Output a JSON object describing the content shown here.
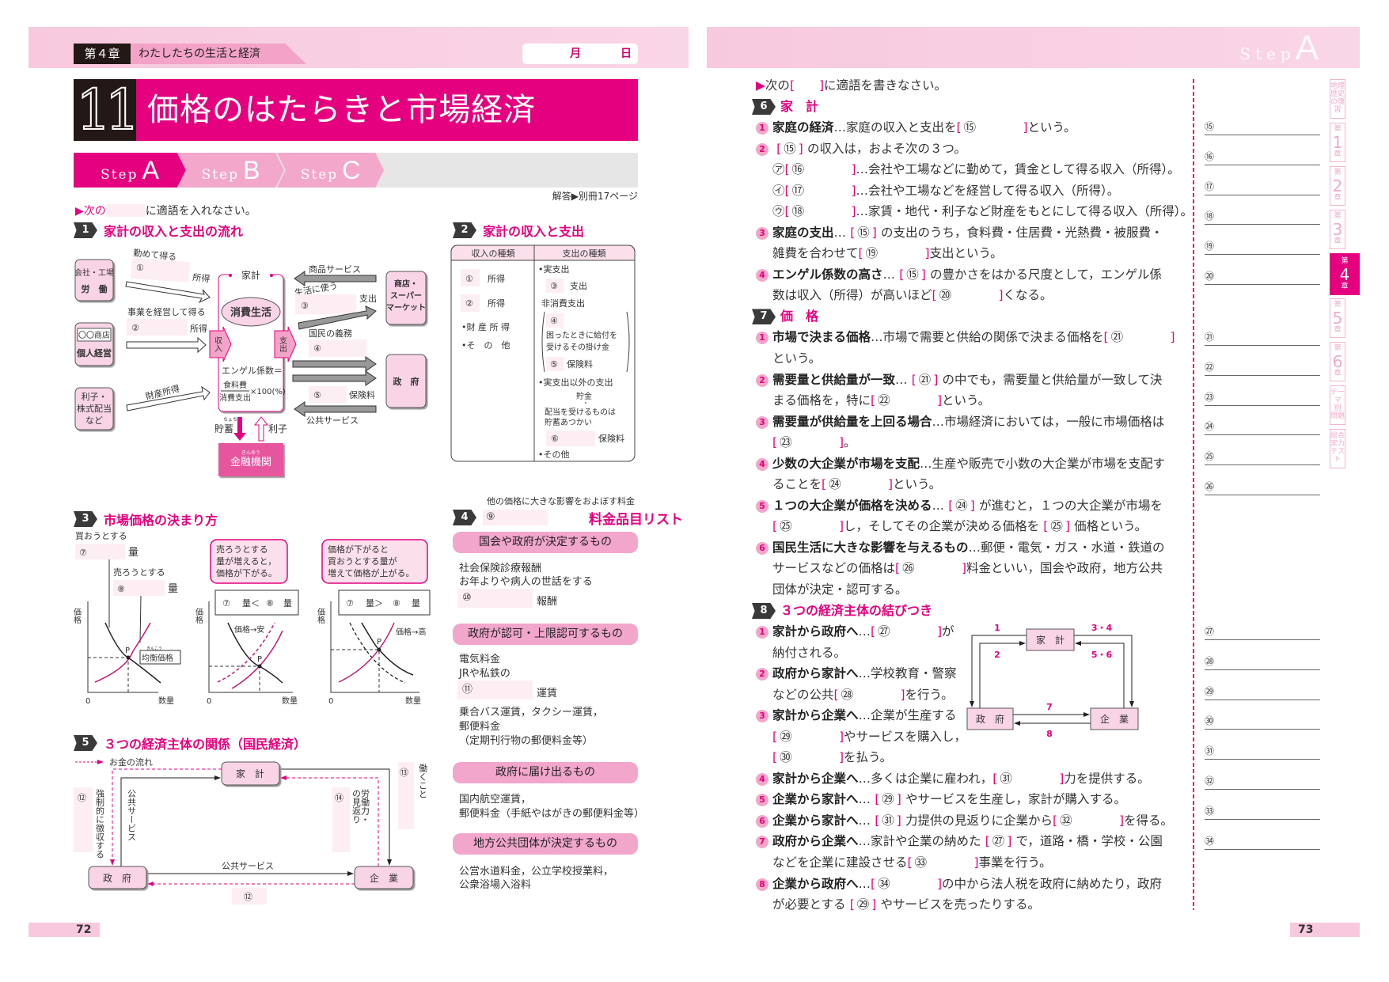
{
  "colors": {
    "accent": "#e4007f",
    "light_pink": "#f8c9de",
    "pill": "#f2a6cc",
    "blank": "#fdeef4"
  },
  "left": {
    "chapter_label": "第４章",
    "chapter_title": "わたしたちの生活と経済",
    "date_month": "月",
    "date_day": "日",
    "lesson_number": "11",
    "lesson_title": "価格のはたらきと市場経済",
    "steps": [
      {
        "word": "Step",
        "letter": "A",
        "active": true
      },
      {
        "word": "Step",
        "letter": "B",
        "active": false
      },
      {
        "word": "Step",
        "letter": "C",
        "active": false
      }
    ],
    "answer_ref": "解答▶別冊17ページ",
    "instruction_prefix": "▶次の",
    "instruction_suffix": "に適語を入れなさい。",
    "s1": {
      "num": "1",
      "title": "家計の収入と支出の流れ",
      "work_box": [
        "会社・工場",
        "労　働"
      ],
      "business_box": [
        "〇〇商店",
        "個人経営"
      ],
      "dividend_box": [
        "利子・",
        "株式配当",
        "など"
      ],
      "household": "家計",
      "consumption": "消費生活",
      "income_tab": "収入",
      "expense_tab": "支出",
      "engel_label": "エンゲル係数＝",
      "engel_num": "食料費",
      "engel_den": "消費支出",
      "engel_mult": "×100(%)",
      "savings": "貯蓄",
      "savings_ruby": "ちょちく",
      "interest": "利子",
      "bank": "金融機関",
      "bank_ruby": "きんゆう",
      "employed": "勤めて得る",
      "b1": "①",
      "income": "所得",
      "managed": "事業を経営して得る",
      "b2": "②",
      "property": "財産所得",
      "goods": "商品サービス",
      "living": "生活に使う",
      "b3": "③",
      "expense": "支出",
      "duty": "国民の義務",
      "b4": "④",
      "b5": "⑤",
      "insurance": "保険料",
      "public": "公共サービス",
      "store_box": [
        "商店・",
        "スーパー",
        "マーケット"
      ],
      "gov_box": "政　府"
    },
    "s2": {
      "num": "2",
      "title": "家計の収入と支出",
      "col_income": "収入の種類",
      "col_expense": "支出の種類",
      "income_rows": [
        {
          "blank": "①",
          "text": "所得"
        },
        {
          "blank": "②",
          "text": "所得"
        }
      ],
      "income_other": [
        "•財 産 所 得",
        "•そ　の　他"
      ],
      "real_exp": "•実支出",
      "b3": "③",
      "exp3": "支出",
      "non_cons": "非消費支出",
      "b4": "④",
      "mutual": [
        "困ったときに給付を",
        "受けるその掛け金"
      ],
      "b5": "⑤",
      "ins5": "保険料",
      "non_real": "•実支出以外の支出",
      "saving": "貯金",
      "dot": "・",
      "dividend_like": [
        "配当を受けるものは",
        "貯蓄あつかい"
      ],
      "b6": "⑥",
      "ins6": "保険料",
      "other": "•その他"
    },
    "s3": {
      "num": "3",
      "title": "市場価格の決まり方",
      "buy": "買おうとする",
      "b7": "⑦",
      "qty": "量",
      "sell": "売ろうとする",
      "b8": "⑧",
      "price_axis": "価格",
      "qty_axis": "数量",
      "origin": "0",
      "p": "P",
      "equilibrium": "均衡価格",
      "eq_ruby": "きんこう",
      "callout1": [
        "売ろうとする",
        "量が増えると，",
        "価格が下がる。"
      ],
      "callout2": [
        "価格が下がると",
        "買おうとする量が",
        "増えて価格が上がる。"
      ],
      "cmp1": [
        "⑦",
        "量＜",
        "⑧",
        "量"
      ],
      "cmp2": [
        "⑦",
        "量＞",
        "⑧",
        "量"
      ],
      "cheap": "価格→安",
      "high": "価格→高"
    },
    "s4": {
      "num": "4",
      "note": "他の価格に大きな影響をおよぼす料金",
      "b9": "⑨",
      "title": "料金品目リスト",
      "groups": [
        {
          "label": "国会や政府が決定するもの",
          "lines": [
            "社会保険診療報酬",
            "お年よりや病人の世話をする"
          ],
          "blank": "⑩",
          "after": "報酬",
          "extra": []
        },
        {
          "label": "政府が認可・上限認可するもの",
          "lines": [
            "電気料金",
            "JRや私鉄の"
          ],
          "blank": "⑪",
          "after": "運賃",
          "extra": [
            "乗合バス運賃，タクシー運賃，",
            "郵便料金",
            "（定期刊行物の郵便料金等）"
          ]
        },
        {
          "label": "政府に届け出るもの",
          "lines": [
            "国内航空運賃，",
            "郵便料金（手紙やはがきの郵便料金等）"
          ]
        },
        {
          "label": "地方公共団体が決定するもの",
          "lines": [
            "公営水道料金，公立学校授業料，",
            "公衆浴場入浴料"
          ]
        }
      ]
    },
    "s5": {
      "num": "5",
      "title": "３つの経済主体の関係（国民経済）",
      "legend": "お金の流れ",
      "household": "家　計",
      "gov": "政　府",
      "firm": "企　業",
      "b12": "⑫",
      "forced": "強制的に徴収する",
      "public_v": "公共サービス",
      "b14": "⑭",
      "labor_return": [
        "労働力・",
        "の見返り"
      ],
      "b13": "⑬",
      "working": "働くこと",
      "public_h": "公共サービス"
    },
    "page_number": "72"
  },
  "right": {
    "header_step": {
      "word": "Step",
      "letter": "A"
    },
    "lines": [
      [
        [
          "k",
          "▶"
        ],
        [
          "t",
          "次の"
        ],
        [
          "k",
          "[　　]"
        ],
        [
          "t",
          "に適語を書きなさい。"
        ]
      ],
      [
        [
          "h",
          "6"
        ],
        [
          "ht",
          "家　計"
        ]
      ],
      [
        [
          "n",
          "1"
        ],
        [
          "b",
          "家庭の経済"
        ],
        [
          "t",
          "…家庭の収入と支出を"
        ],
        [
          "bl",
          "⑮"
        ],
        [
          "t",
          "という。"
        ]
      ],
      [
        [
          "n",
          "2"
        ],
        [
          "rf",
          "⑮"
        ],
        [
          "t",
          "の収入は，およそ次の３つ。"
        ]
      ],
      [
        [
          "t",
          "㋐"
        ],
        [
          "bl",
          "⑯"
        ],
        [
          "t",
          "…会社や工場などに勤めて，賃金として得る収入（所得）。"
        ]
      ],
      [
        [
          "t",
          "㋑"
        ],
        [
          "bl",
          "⑰"
        ],
        [
          "t",
          "…会社や工場などを経営して得る収入（所得）。"
        ]
      ],
      [
        [
          "t",
          "㋒"
        ],
        [
          "bl",
          "⑱"
        ],
        [
          "t",
          "…家賃・地代・利子など財産をもとにして得る収入（所得）。"
        ]
      ],
      [
        [
          "n",
          "3"
        ],
        [
          "b",
          "家庭の支出"
        ],
        [
          "t",
          "…"
        ],
        [
          "rf",
          "⑮"
        ],
        [
          "t",
          "の支出のうち，食料費・住居費・光熱費・被服費・"
        ]
      ],
      [
        [
          "t",
          "雑費を合わせて"
        ],
        [
          "bl",
          "⑲"
        ],
        [
          "t",
          "支出という。"
        ]
      ],
      [
        [
          "n",
          "4"
        ],
        [
          "b",
          "エンゲル係数の高さ"
        ],
        [
          "t",
          "…"
        ],
        [
          "rf",
          "⑮"
        ],
        [
          "t",
          "の豊かさをはかる尺度として，エンゲル係"
        ]
      ],
      [
        [
          "t",
          "数は収入（所得）が高いほど"
        ],
        [
          "bl",
          "⑳"
        ],
        [
          "t",
          "くなる。"
        ]
      ],
      [
        [
          "h",
          "7"
        ],
        [
          "ht",
          "価　格"
        ]
      ],
      [
        [
          "n",
          "1"
        ],
        [
          "b",
          "市場で決まる価格"
        ],
        [
          "t",
          "…市場で需要と供給の関係で決まる価格を"
        ],
        [
          "bl",
          "㉑"
        ]
      ],
      [
        [
          "t",
          "という。"
        ]
      ],
      [
        [
          "n",
          "2"
        ],
        [
          "b",
          "需要量と供給量が一致"
        ],
        [
          "t",
          "…"
        ],
        [
          "rf",
          "㉑"
        ],
        [
          "t",
          "の中でも，需要量と供給量が一致して決"
        ]
      ],
      [
        [
          "t",
          "まる価格を，特に"
        ],
        [
          "bl",
          "㉒"
        ],
        [
          "t",
          "という。"
        ]
      ],
      [
        [
          "n",
          "3"
        ],
        [
          "b",
          "需要量が供給量を上回る場合"
        ],
        [
          "t",
          "…市場経済においては，一般に市場価格は"
        ]
      ],
      [
        [
          "bl",
          "㉓"
        ],
        [
          "t",
          "。"
        ]
      ],
      [
        [
          "n",
          "4"
        ],
        [
          "b",
          "少数の大企業が市場を支配"
        ],
        [
          "t",
          "…生産や販売で小数の大企業が市場を支配す"
        ]
      ],
      [
        [
          "t",
          "ることを"
        ],
        [
          "bl",
          "㉔"
        ],
        [
          "t",
          "という。"
        ]
      ],
      [
        [
          "n",
          "5"
        ],
        [
          "b",
          "１つの大企業が価格を決める"
        ],
        [
          "t",
          "…"
        ],
        [
          "rf",
          "㉔"
        ],
        [
          "t",
          "が進むと，１つの大企業が市場を"
        ]
      ],
      [
        [
          "bl",
          "㉕"
        ],
        [
          "t",
          "し，そしてその企業が決める価格を"
        ],
        [
          "rf",
          "㉕"
        ],
        [
          "t",
          "価格という。"
        ]
      ],
      [
        [
          "n",
          "6"
        ],
        [
          "b",
          "国民生活に大きな影響を与えるもの"
        ],
        [
          "t",
          "…郵便・電気・ガス・水道・鉄道の"
        ]
      ],
      [
        [
          "t",
          "サービスなどの価格は"
        ],
        [
          "bl",
          "㉖"
        ],
        [
          "t",
          "料金といい，国会や政府，地方公共"
        ]
      ],
      [
        [
          "t",
          "団体が決定・認可する。"
        ]
      ],
      [
        [
          "h",
          "8"
        ],
        [
          "ht",
          "３つの経済主体の結びつき"
        ]
      ],
      [
        [
          "n",
          "1"
        ],
        [
          "b",
          "家計から政府へ"
        ],
        [
          "t",
          "…"
        ],
        [
          "bl",
          "㉗"
        ],
        [
          "t",
          "が"
        ]
      ],
      [
        [
          "t",
          "納付される。"
        ]
      ],
      [
        [
          "n",
          "2"
        ],
        [
          "b",
          "政府から家計へ"
        ],
        [
          "t",
          "…学校教育・警察"
        ]
      ],
      [
        [
          "t",
          "などの公共"
        ],
        [
          "bl",
          "㉘"
        ],
        [
          "t",
          "を行う。"
        ]
      ],
      [
        [
          "n",
          "3"
        ],
        [
          "b",
          "家計から企業へ"
        ],
        [
          "t",
          "…企業が生産する"
        ]
      ],
      [
        [
          "bl",
          "㉙"
        ],
        [
          "t",
          "やサービスを購入し，"
        ]
      ],
      [
        [
          "bl",
          "㉚"
        ],
        [
          "t",
          "を払う。"
        ]
      ],
      [
        [
          "n",
          "4"
        ],
        [
          "b",
          "家計から企業へ"
        ],
        [
          "t",
          "…多くは企業に雇われ，"
        ],
        [
          "bl",
          "㉛"
        ],
        [
          "t",
          "力を提供する。"
        ]
      ],
      [
        [
          "n",
          "5"
        ],
        [
          "b",
          "企業から家計へ"
        ],
        [
          "t",
          "…"
        ],
        [
          "rf",
          "㉙"
        ],
        [
          "t",
          "やサービスを生産し，家計が購入する。"
        ]
      ],
      [
        [
          "n",
          "6"
        ],
        [
          "b",
          "企業から家計へ"
        ],
        [
          "t",
          "…"
        ],
        [
          "rf",
          "㉛"
        ],
        [
          "t",
          "力提供の見返りに企業から"
        ],
        [
          "bl",
          "㉜"
        ],
        [
          "t",
          "を得る。"
        ]
      ],
      [
        [
          "n",
          "7"
        ],
        [
          "b",
          "政府から企業へ"
        ],
        [
          "t",
          "…家計や企業の納めた"
        ],
        [
          "rf",
          "㉗"
        ],
        [
          "t",
          "で，道路・橋・学校・公園"
        ]
      ],
      [
        [
          "t",
          "などを企業に建設させる"
        ],
        [
          "bl",
          "㉝"
        ],
        [
          "t",
          "事業を行う。"
        ]
      ],
      [
        [
          "n",
          "8"
        ],
        [
          "b",
          "企業から政府へ"
        ],
        [
          "t",
          "…"
        ],
        [
          "bl",
          "㉞"
        ],
        [
          "t",
          "の中から法人税を政府に納めたり，政府"
        ]
      ],
      [
        [
          "t",
          "が必要とする"
        ],
        [
          "rf",
          "㉙"
        ],
        [
          "t",
          "やサービスを売ったりする。"
        ]
      ]
    ],
    "diagram8": {
      "household": "家　計",
      "gov": "政　府",
      "firm": "企　業",
      "l1": "1",
      "l2": "2",
      "l34": "3・4",
      "l56": "5・6",
      "l7": "7",
      "l8": "8"
    },
    "answer_groups": [
      [
        "⑮",
        "⑯",
        "⑰",
        "⑱",
        "⑲",
        "⑳"
      ],
      [
        "㉑",
        "㉒",
        "㉓",
        "㉔",
        "㉕",
        "㉖"
      ],
      [
        "㉗",
        "㉘",
        "㉙",
        "㉚",
        "㉛",
        "㉜",
        "㉝",
        "㉞"
      ]
    ],
    "tabs": [
      {
        "top": "地理",
        "mid": "歴史",
        "bot": "の復習",
        "active": false
      },
      {
        "top": "第",
        "mid": "1",
        "bot": "章",
        "active": false
      },
      {
        "top": "第",
        "mid": "2",
        "bot": "章",
        "active": false
      },
      {
        "top": "第",
        "mid": "3",
        "bot": "章",
        "active": false
      },
      {
        "top": "第",
        "mid": "4",
        "bot": "章",
        "active": true
      },
      {
        "top": "第",
        "mid": "5",
        "bot": "章",
        "active": false
      },
      {
        "top": "第",
        "mid": "6",
        "bot": "章",
        "active": false
      },
      {
        "top": "テーマ",
        "mid": "別",
        "bot": "問題",
        "active": false
      },
      {
        "top": "総合",
        "mid": "実力",
        "bot": "テスト",
        "active": false
      }
    ],
    "page_number": "73"
  }
}
